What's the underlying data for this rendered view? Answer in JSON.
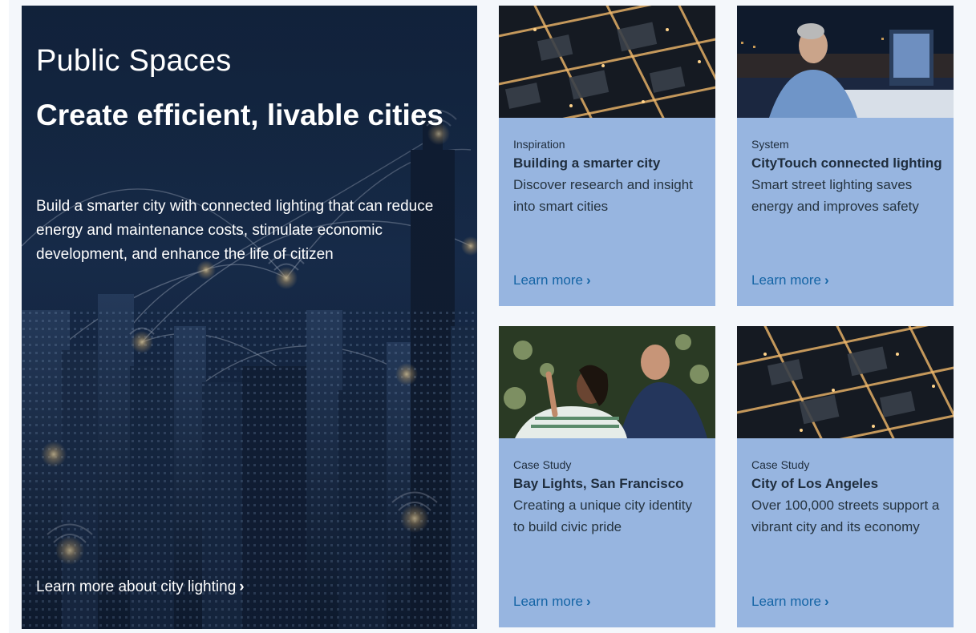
{
  "hero": {
    "eyebrow": "Public Spaces",
    "title": "Create efficient, livable cities",
    "description": "Build a smarter city with connected lighting that can reduce energy and maintenance costs, stimulate economic development, and enhance the life of citizen",
    "link_label": "Learn more about city lighting",
    "chevron": "›"
  },
  "cards": [
    {
      "kicker": "Inspiration",
      "title": "Building a smarter city",
      "description": "Discover research and insight into smart cities",
      "link_label": "Learn more",
      "chevron": "›"
    },
    {
      "kicker": "System",
      "title": "CityTouch connected lighting",
      "description": "Smart street lighting saves energy and improves safety",
      "link_label": "Learn more",
      "chevron": "›"
    },
    {
      "kicker": "Case Study",
      "title": "Bay Lights, San Francisco",
      "description": "Creating a unique city identity to build civic pride",
      "link_label": "Learn more",
      "chevron": "›"
    },
    {
      "kicker": "Case Study",
      "title": "City of Los Angeles",
      "description": "Over 100,000 streets support a vibrant city and its economy",
      "link_label": "Learn more",
      "chevron": "›"
    }
  ],
  "colors": {
    "card_background": "#97b5e0",
    "link": "#1464a5",
    "hero_background": "#1a2f4f",
    "text_dark": "#1f2d3d"
  }
}
